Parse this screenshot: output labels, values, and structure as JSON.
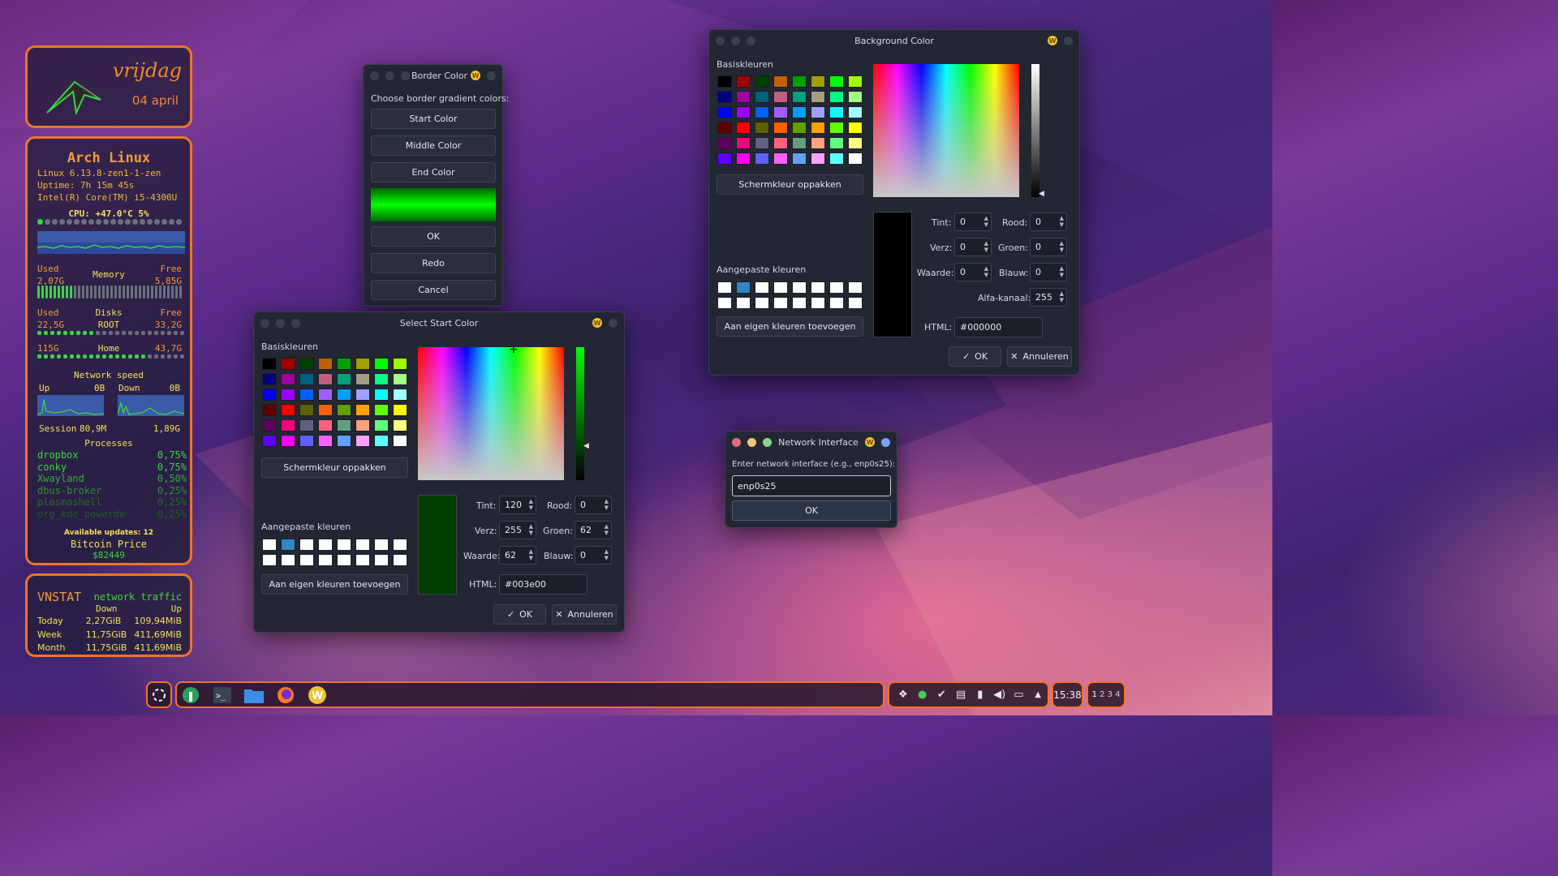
{
  "date_widget": {
    "weekday": "vrijdag",
    "date": "04 april"
  },
  "sysinfo": {
    "os": "Arch Linux",
    "kernel": "Linux 6.13.8-zen1-1-zen",
    "uptime": "Uptime: 7h 15m 45s",
    "cpu_model": "Intel(R) Core(TM) i5-4300U",
    "cpu_line": "CPU: +47.0°C 5%",
    "cpu_dots_active": 1,
    "memory": {
      "used_label": "Used",
      "title": "Memory",
      "free_label": "Free",
      "used": "2,07G",
      "free": "5,85G",
      "bar_fraction": 0.26
    },
    "disks": {
      "used_label": "Used",
      "title": "Disks",
      "free_label": "Free",
      "root_used": "22,5G",
      "root_name": "ROOT",
      "root_free": "33,2G",
      "root_fraction": 0.4,
      "home_used": "115G",
      "home_name": "Home",
      "home_free": "43,7G",
      "home_fraction": 0.73
    },
    "network": {
      "title": "Network speed",
      "up_label": "Up",
      "up_value": "0B",
      "down_label": "Down",
      "down_value": "0B",
      "session_label": "Session",
      "session_up": "80,9M",
      "session_down": "1,89G"
    },
    "processes": {
      "title": "Processes",
      "items": [
        {
          "name": "dropbox",
          "pct": "0,75%"
        },
        {
          "name": "conky",
          "pct": "0,75%"
        },
        {
          "name": "Xwayland",
          "pct": "0,50%"
        },
        {
          "name": "dbus-broker",
          "pct": "0,25%"
        },
        {
          "name": "plasmashell",
          "pct": "0,25%"
        },
        {
          "name": "org_kde_powerde",
          "pct": "0,25%"
        }
      ]
    },
    "updates": "Available updates: 12",
    "bitcoin_label": "Bitcoin Price",
    "bitcoin_value": "$82449"
  },
  "vnstat": {
    "title": "VNSTAT",
    "subtitle": "network traffic",
    "col_down": "Down",
    "col_up": "Up",
    "rows": [
      {
        "label": "Today",
        "down": "2,27GiB",
        "up": "109,94MiB"
      },
      {
        "label": "Week",
        "down": "11,75GiB",
        "up": "411,69MiB"
      },
      {
        "label": "Month",
        "down": "11,75GiB",
        "up": "411,69MiB"
      }
    ]
  },
  "border_dialog": {
    "title": "Border Color",
    "prompt": "Choose border gradient colors:",
    "start": "Start Color",
    "middle": "Middle Color",
    "end": "End Color",
    "ok": "OK",
    "redo": "Redo",
    "cancel": "Cancel"
  },
  "color_dialog_common": {
    "basic_colors": "Basiskleuren",
    "pick_screen": "Schermkleur oppakken",
    "custom_colors": "Aangepaste kleuren",
    "add_custom": "Aan eigen kleuren toevoegen",
    "hue_label": "Tint:",
    "sat_label": "Verz:",
    "val_label": "Waarde:",
    "red_label": "Rood:",
    "green_label": "Groen:",
    "blue_label": "Blauw:",
    "alpha_label": "Alfa-kanaal:",
    "html_label": "HTML:",
    "ok": "OK",
    "cancel": "Annuleren"
  },
  "start_color_dialog": {
    "title": "Select Start Color",
    "hue": "120",
    "sat": "255",
    "val": "62",
    "red": "0",
    "green": "62",
    "blue": "0",
    "html": "#003e00",
    "preview_color": "#003e00"
  },
  "bg_color_dialog": {
    "title": "Background Color",
    "hue": "0",
    "sat": "0",
    "val": "0",
    "red": "0",
    "green": "0",
    "blue": "0",
    "alpha": "255",
    "html": "#000000",
    "preview_color": "#000000"
  },
  "basic_palette": [
    "#000000",
    "#a00000",
    "#004000",
    "#c06000",
    "#00a000",
    "#a0a000",
    "#00ff00",
    "#a0ff00",
    "#000080",
    "#a000a0",
    "#006080",
    "#c06080",
    "#00a080",
    "#a0a080",
    "#00ff80",
    "#a0ff80",
    "#0000ff",
    "#a000ff",
    "#0060ff",
    "#a060ff",
    "#00a0ff",
    "#a0a0ff",
    "#00ffff",
    "#a0ffff",
    "#600000",
    "#ff0000",
    "#606000",
    "#ff6000",
    "#60a000",
    "#ffa000",
    "#60ff00",
    "#ffff00",
    "#600060",
    "#ff0080",
    "#606080",
    "#ff6080",
    "#60a080",
    "#ffa080",
    "#60ff80",
    "#ffff80",
    "#6000ff",
    "#ff00ff",
    "#6060ff",
    "#ff60ff",
    "#60a0ff",
    "#ffa0ff",
    "#60ffff",
    "#ffffff"
  ],
  "custom_palette": [
    "#ffffff",
    "#2f86c8",
    "#ffffff",
    "#ffffff",
    "#ffffff",
    "#ffffff",
    "#ffffff",
    "#ffffff",
    "#ffffff",
    "#ffffff",
    "#ffffff",
    "#ffffff",
    "#ffffff",
    "#ffffff",
    "#ffffff",
    "#ffffff"
  ],
  "network_dialog": {
    "title": "Network Interface",
    "prompt": "Enter network interface (e.g., enp0s25):",
    "value": "enp0s25",
    "ok": "OK"
  },
  "taskbar": {
    "apps": [
      "launcher-icon",
      "keepassxc-icon",
      "terminal-icon",
      "files-icon",
      "firefox-icon",
      "wallpaper-app-icon"
    ],
    "tray_icons": [
      "dropbox-icon",
      "location-icon",
      "vpn-icon",
      "clipboard-icon",
      "battery-icon",
      "volume-icon",
      "network-icon",
      "expand-tray-icon"
    ],
    "clock": "15:38",
    "workspaces": [
      "1",
      "2",
      "3",
      "4"
    ]
  }
}
